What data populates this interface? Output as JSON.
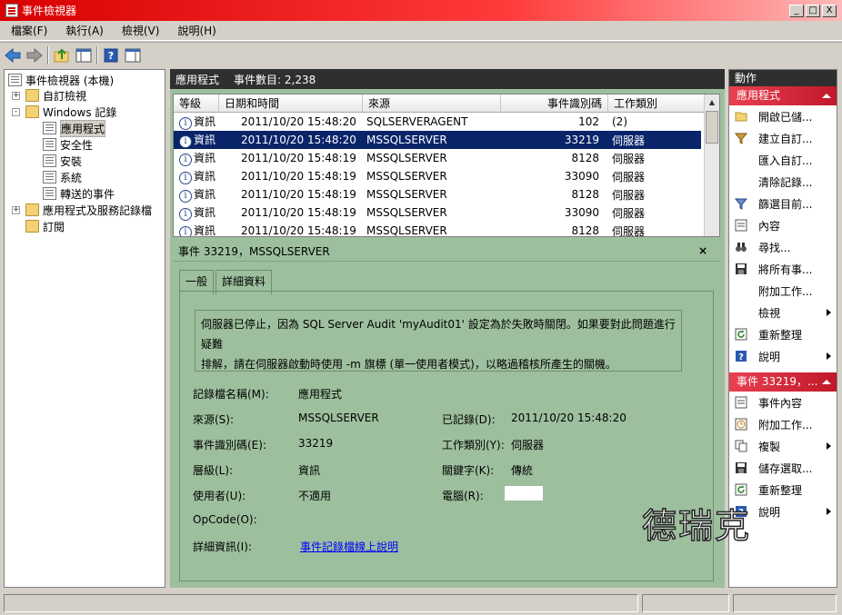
{
  "window": {
    "title": "事件檢視器",
    "btn_min": "_",
    "btn_max": "□",
    "btn_close": "X"
  },
  "menu": [
    "檔案(F)",
    "執行(A)",
    "檢視(V)",
    "說明(H)"
  ],
  "tree": {
    "items": [
      {
        "label": "事件檢視器 (本機)",
        "expander": ""
      },
      {
        "label": "自訂檢視",
        "expander": "+"
      },
      {
        "label": "Windows 記錄",
        "expander": "-"
      },
      {
        "label": "應用程式",
        "expander": ""
      },
      {
        "label": "安全性",
        "expander": ""
      },
      {
        "label": "安裝",
        "expander": ""
      },
      {
        "label": "系統",
        "expander": ""
      },
      {
        "label": "轉送的事件",
        "expander": ""
      },
      {
        "label": "應用程式及服務記錄檔",
        "expander": "+"
      },
      {
        "label": "訂閱",
        "expander": ""
      }
    ]
  },
  "center": {
    "log_name": "應用程式",
    "event_count": "事件數目: 2,238",
    "columns": [
      "等級",
      "日期和時間",
      "來源",
      "事件識別碼",
      "工作類別"
    ],
    "rows": [
      {
        "level": "資訊",
        "datetime": "2011/10/20 15:48:20",
        "source": "SQLSERVERAGENT",
        "id": "102",
        "category": "(2)"
      },
      {
        "level": "資訊",
        "datetime": "2011/10/20 15:48:20",
        "source": "MSSQLSERVER",
        "id": "33219",
        "category": "伺服器"
      },
      {
        "level": "資訊",
        "datetime": "2011/10/20 15:48:19",
        "source": "MSSQLSERVER",
        "id": "8128",
        "category": "伺服器"
      },
      {
        "level": "資訊",
        "datetime": "2011/10/20 15:48:19",
        "source": "MSSQLSERVER",
        "id": "33090",
        "category": "伺服器"
      },
      {
        "level": "資訊",
        "datetime": "2011/10/20 15:48:19",
        "source": "MSSQLSERVER",
        "id": "8128",
        "category": "伺服器"
      },
      {
        "level": "資訊",
        "datetime": "2011/10/20 15:48:19",
        "source": "MSSQLSERVER",
        "id": "33090",
        "category": "伺服器"
      },
      {
        "level": "資訊",
        "datetime": "2011/10/20 15:48:19",
        "source": "MSSQLSERVER",
        "id": "8128",
        "category": "伺服器"
      }
    ],
    "info_glyph": "i"
  },
  "detail": {
    "header": "事件 33219，MSSQLSERVER",
    "close": "×",
    "tabs": [
      "一般",
      "詳細資料"
    ],
    "message_line1": "伺服器已停止，因為 SQL Server Audit 'myAudit01' 設定為於失敗時關閉。如果要對此問題進行疑難",
    "message_line2": "排解，請在伺服器啟動時使用 -m 旗標 (單一使用者模式)，以略過稽核所產生的關機。",
    "log_name_label": "記錄檔名稱(M):",
    "log_name_value": "應用程式",
    "source_label": "來源(S):",
    "source_value": "MSSQLSERVER",
    "logged_label": "已記錄(D):",
    "logged_value": "2011/10/20 15:48:20",
    "event_id_label": "事件識別碼(E):",
    "event_id_value": "33219",
    "category_label": "工作類別(Y):",
    "category_value": "伺服器",
    "level_label": "層級(L):",
    "level_value": "資訊",
    "keywords_label": "關鍵字(K):",
    "keywords_value": "傳統",
    "user_label": "使用者(U):",
    "user_value": "不適用",
    "computer_label": "電腦(R):",
    "opcode_label": "OpCode(O):",
    "more_info_label": "詳細資訊(I):",
    "more_info_link": "事件記錄檔線上說明"
  },
  "actions": {
    "header": "動作",
    "section1": "應用程式",
    "items1": [
      "開啟已儲...",
      "建立自訂...",
      "匯入自訂...",
      "清除記錄...",
      "篩選目前...",
      "內容",
      "尋找...",
      "將所有事...",
      "附加工作...",
      "檢視",
      "重新整理",
      "說明"
    ],
    "section2": "事件 33219，...",
    "items2": [
      "事件內容",
      "附加工作...",
      "複製",
      "儲存選取...",
      "重新整理",
      "說明"
    ]
  },
  "watermark": "德瑞克",
  "colors": {
    "title_red": "#d80000",
    "selected_row": "#0a246a",
    "detail_bg": "#9dbf9d",
    "action_section": "#d02030"
  }
}
